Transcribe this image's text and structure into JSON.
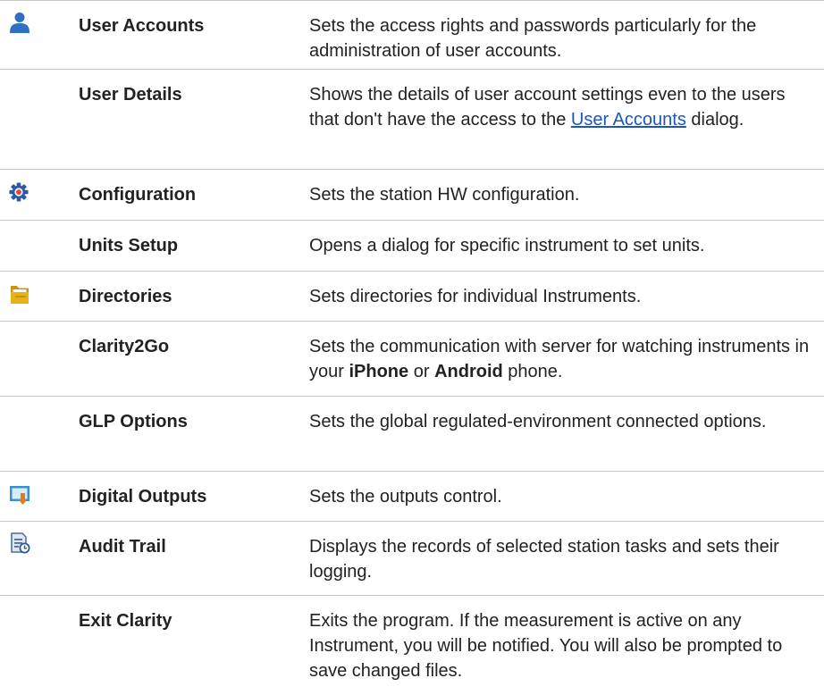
{
  "colors": {
    "user_icon": "#2f6fc4",
    "gear_icon": "#2d5aa8",
    "gear_center": "#e0452e",
    "folder_icon": "#e6b316",
    "outputs_icon": "#3a8fd0",
    "outputs_arrow": "#e07a1a",
    "audit_icon": "#4a6d9a",
    "link": "#1a56c2",
    "divider": "#c8c8c8"
  },
  "rows": [
    {
      "icon": "user-icon",
      "name": "User Accounts",
      "desc": "Sets the access rights and passwords particularly for the administration of user accounts."
    },
    {
      "icon": "",
      "name": "User Details",
      "desc_before": "Shows the details of user account settings even to the users that don't have the access to the",
      "desc_link": "User Accounts",
      "desc_after": "dialog."
    },
    {
      "icon": "gear-icon",
      "name": "Configuration",
      "desc": "Sets the station HW configuration."
    },
    {
      "icon": "",
      "name": "Units Setup",
      "desc": "Opens a dialog for specific instrument to set units."
    },
    {
      "icon": "folder-icon",
      "name": "Directories",
      "desc": "Sets directories for individual Instruments."
    },
    {
      "icon": "",
      "name": "Clarity2Go",
      "desc_before": "Sets the communication with server for watching instruments in your",
      "desc_bold1": "iPhone",
      "desc_mid": "or",
      "desc_bold2": "Android",
      "desc_after": "phone."
    },
    {
      "icon": "",
      "name": "GLP Options",
      "desc": "Sets the global regulated-environment connected options."
    },
    {
      "icon": "digital-outputs-icon",
      "name": "Digital Outputs",
      "desc": "Sets the outputs control."
    },
    {
      "icon": "audit-trail-icon",
      "name": "Audit Trail",
      "desc": "Displays the records of selected station tasks and sets their logging."
    },
    {
      "icon": "",
      "name": "Exit Clarity",
      "desc": "Exits the program. If the measurement is active on any Instrument, you will be notified. You will also be prompted to save changed files."
    }
  ]
}
